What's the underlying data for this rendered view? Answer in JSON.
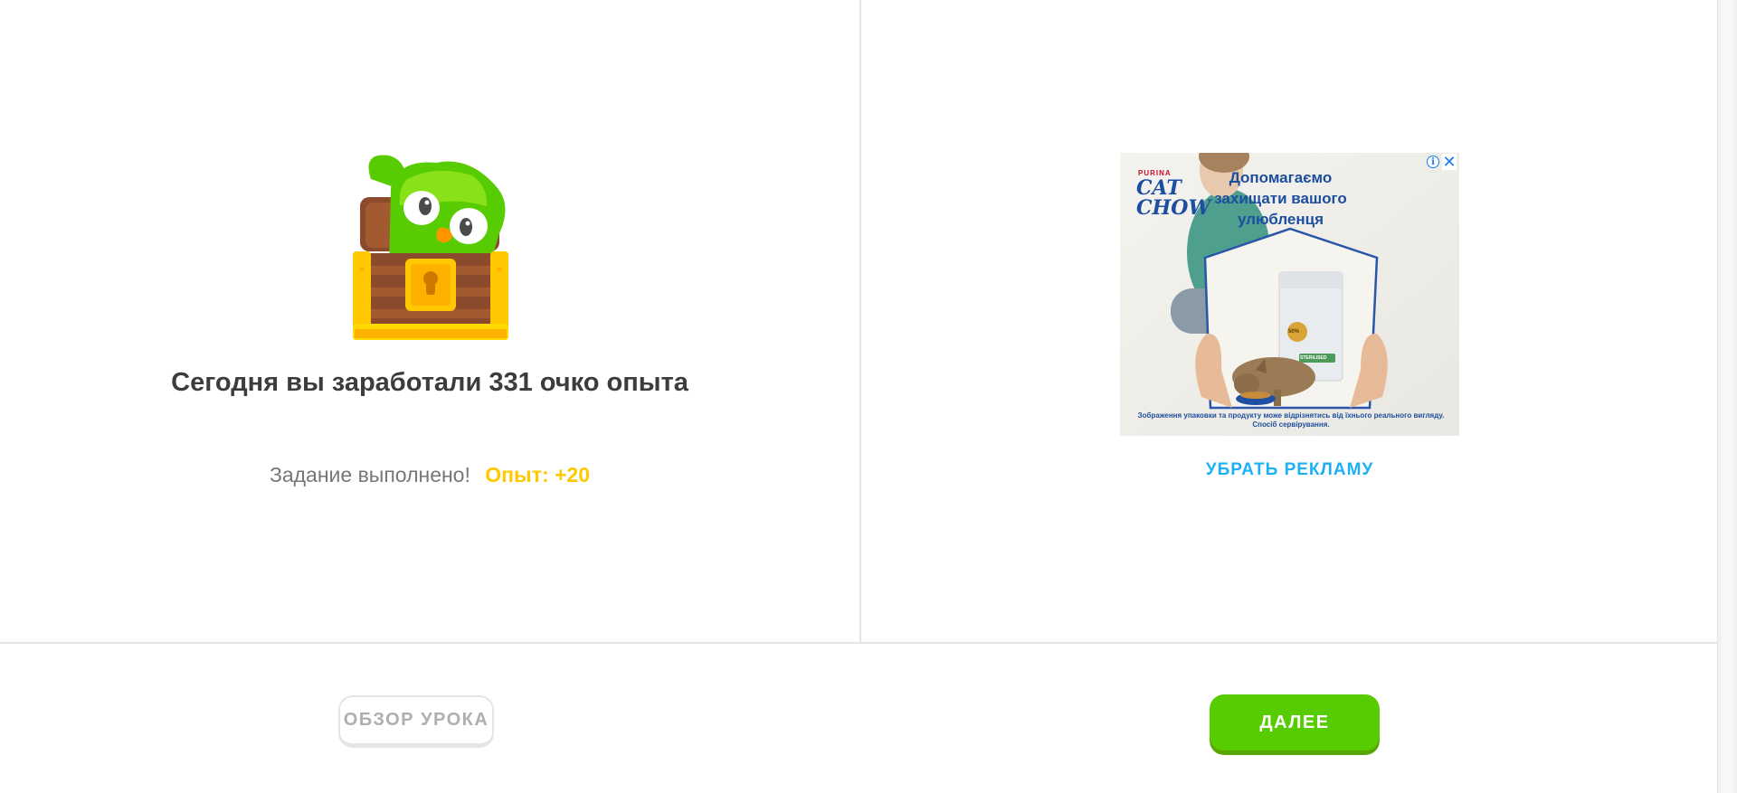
{
  "result": {
    "earned_title": "Сегодня вы заработали 331 очко опыта",
    "task_done": "Задание выполнено!",
    "xp_gain": "Опыт: +20"
  },
  "ad": {
    "brand_small": "PURINA",
    "brand_line1": "CAT",
    "brand_line2": "CHOW",
    "headline": "Допомагаємо захищати вашого улюбленця",
    "disclaimer": "Зображення упаковки та продукту може відрізнятись від їхнього реального вигляду. Спосіб сервірування.",
    "pack_badge": "50%",
    "pack_label": "STERILISED",
    "info_icon": "info-icon",
    "close_icon": "close-icon",
    "remove_ads": "УБРАТЬ РЕКЛАМУ"
  },
  "footer": {
    "review_button": "ОБЗОР УРОКА",
    "next_button": "ДАЛЕЕ"
  },
  "colors": {
    "green": "#58cc02",
    "gold": "#ffc800",
    "blue_link": "#1cb0f6",
    "text_dark": "#3c3c3c",
    "text_grey": "#777777"
  }
}
